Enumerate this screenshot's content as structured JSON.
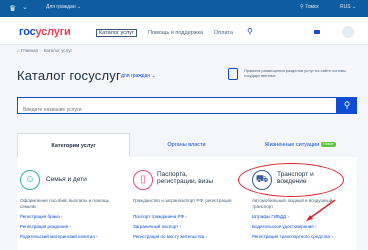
{
  "topbar": {
    "crest": "♛",
    "menu_chevron": "⌄",
    "citizens": "Для граждан ⌄",
    "region": "⚲ Томск",
    "lang": "RUS ⌄"
  },
  "header": {
    "logo_part1": "гос",
    "logo_part2": "услуги",
    "nav": [
      "Каталог услуг",
      "Помощь и поддержка",
      "Оплата"
    ],
    "search_icon": "⚲"
  },
  "breadcrumb": {
    "home": "⌂ Главная",
    "separator": "›",
    "current": "Каталог услуг"
  },
  "page": {
    "title": "Каталог госуслуг",
    "region_select": "для граждан ⌄",
    "info_text": "Правила размещения разделов услуг на сайте основы государственных"
  },
  "search": {
    "placeholder": "Введите название услуги"
  },
  "tabs": [
    {
      "label": "Категории услуг"
    },
    {
      "label": "Органы власти"
    },
    {
      "label": "Жизненные ситуации",
      "badge": "Новое"
    }
  ],
  "categories": [
    {
      "title": "Семья и дети",
      "icon": "family-icon",
      "description": "Оформление пособий, выплаты и помощь семьям",
      "links": [
        "Регистрация брака ›",
        "Регистрация рождения ›",
        "Родительский материнский капитал ›"
      ]
    },
    {
      "title": "Паспорта, регистрации, визы",
      "icon": "passport-icon",
      "description": "Гражданство и загранпаспорт РФ, регистрация",
      "links": [
        "Паспорт гражданина РФ ›",
        "Заграничный паспорт ›",
        "Регистрация по месту жительства ›"
      ]
    },
    {
      "title": "Транспорт и вождение",
      "icon": "car-icon",
      "description": "Автомобильный, водный и воздушный транспорт",
      "links": [
        "Штрафы ГИБДД ›",
        "Водительское удостоверение ›",
        "Регистрация транспортного средства ›"
      ]
    }
  ],
  "colors": {
    "brand_blue": "#0d4cd3",
    "brand_red": "#ee3f58",
    "topbar": "#0f5ca0",
    "annotation_red": "#e0232e",
    "badge_green": "#5ac43b"
  }
}
